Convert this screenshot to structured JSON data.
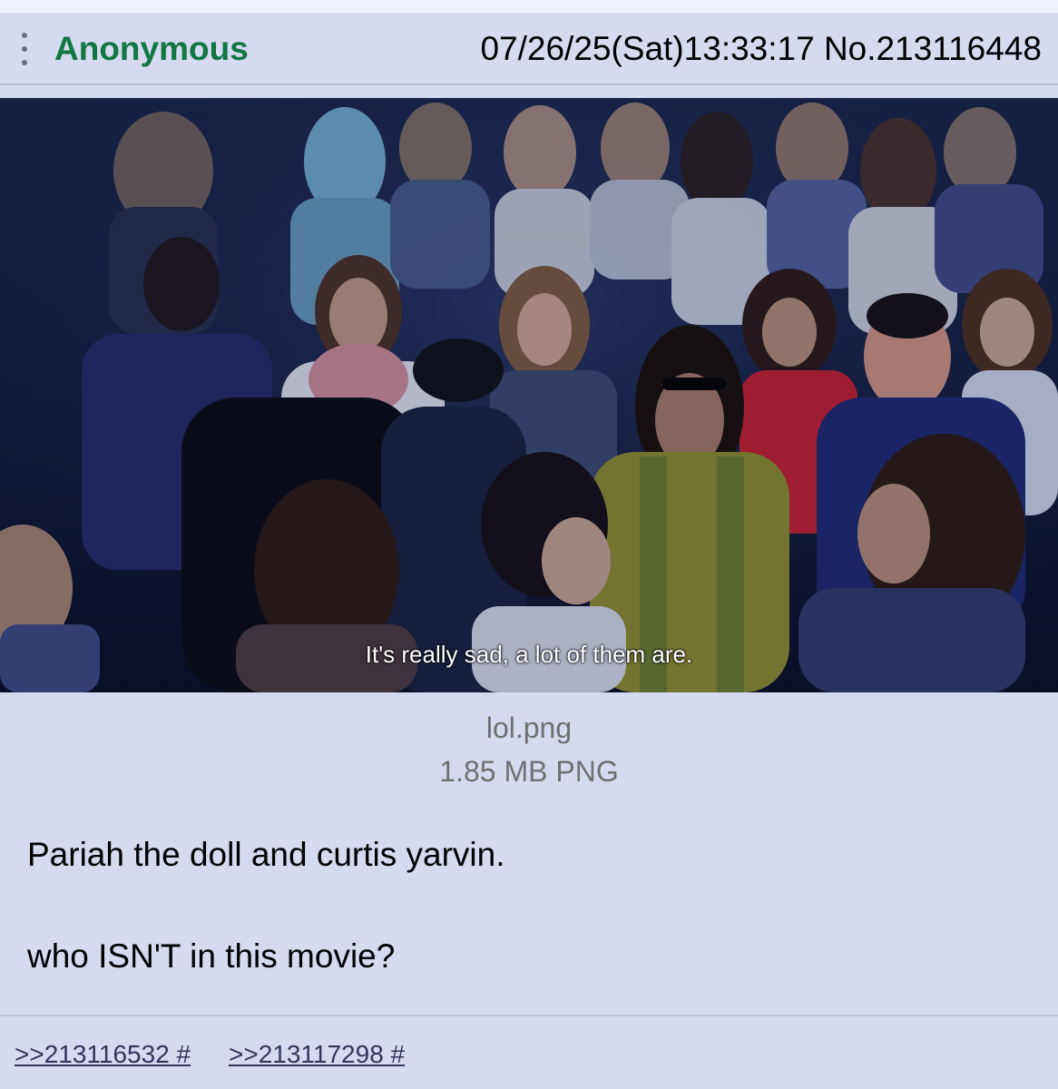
{
  "post": {
    "author": "Anonymous",
    "datetime": "07/26/25(Sat)13:33:17 No.213116448",
    "image": {
      "subtitle": "It's really sad, a lot of them are.",
      "filename": "lol.png",
      "filemeta": "1.85 MB PNG"
    },
    "message": [
      "Pariah the doll and curtis yarvin.",
      "who ISN'T in this movie?"
    ],
    "replies": [
      ">>213116532 #",
      ">>213117298 #"
    ]
  },
  "colors": {
    "post_background": "#d6daf0",
    "name_green": "#117743",
    "link": "#34345c",
    "file_text": "#707070"
  },
  "icons": {
    "menu": "kebab-menu-icon"
  }
}
